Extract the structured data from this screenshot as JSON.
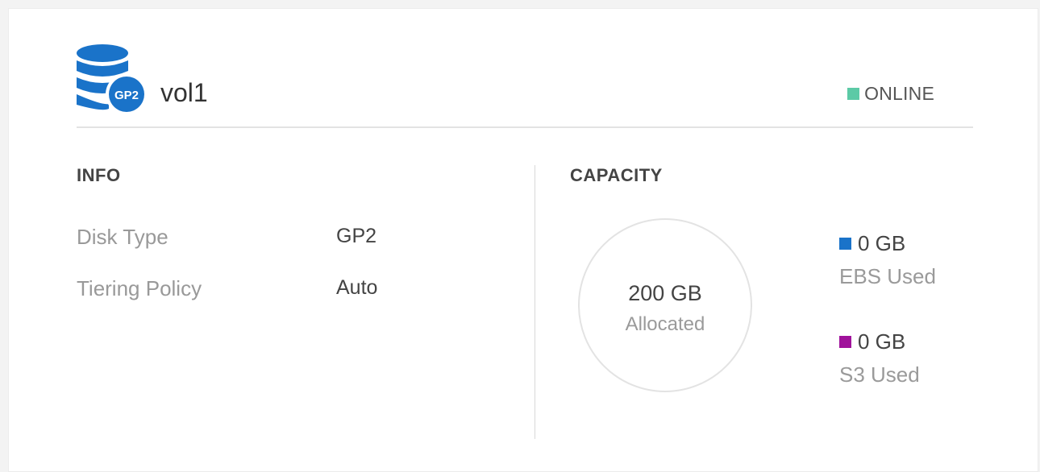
{
  "volume": {
    "name": "vol1",
    "disk_badge": "GP2",
    "status": "ONLINE"
  },
  "info": {
    "title": "INFO",
    "rows": [
      {
        "label": "Disk Type",
        "value": "GP2"
      },
      {
        "label": "Tiering Policy",
        "value": "Auto"
      }
    ]
  },
  "capacity": {
    "title": "CAPACITY",
    "allocated_value": "200 GB",
    "allocated_label": "Allocated",
    "legend": [
      {
        "value": "0 GB",
        "label": "EBS Used",
        "color": "#1a73c9"
      },
      {
        "value": "0 GB",
        "label": "S3 Used",
        "color": "#a0129b"
      }
    ]
  },
  "colors": {
    "brand_blue": "#1a73c9",
    "status_online": "#5ccaa6"
  },
  "icons": {
    "disk": "database-icon"
  }
}
